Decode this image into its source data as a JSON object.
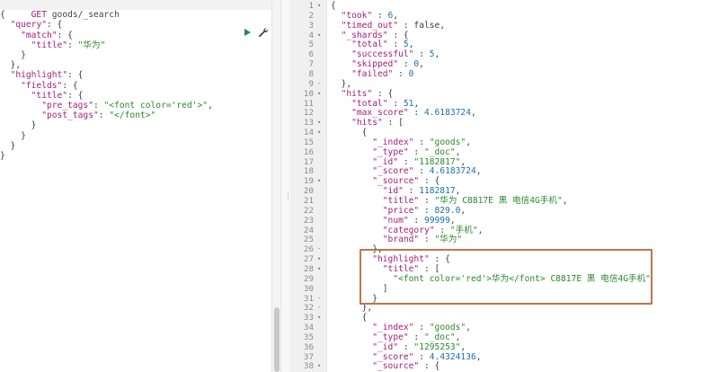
{
  "request": {
    "method": "GET",
    "path": "goods/_search",
    "body_lines": [
      "{",
      "  \"query\": {",
      "    \"match\": {",
      "      \"title\": \"华为\"",
      "    }",
      "  },",
      "  \"highlight\": {",
      "    \"fields\": {",
      "      \"title\": {",
      "        \"pre_tags\": \"<font color='red'>\",",
      "        \"post_tags\": \"</font>\"",
      "      }",
      "    }",
      "  }",
      "}"
    ]
  },
  "toolbar": {
    "run_icon": "play-icon",
    "settings_icon": "wrench-icon"
  },
  "response": {
    "line_numbers": [
      "1",
      "2",
      "3",
      "4",
      "5",
      "6",
      "7",
      "8",
      "9",
      "10",
      "11",
      "12",
      "13",
      "14",
      "15",
      "16",
      "17",
      "18",
      "19",
      "20",
      "21",
      "22",
      "23",
      "24",
      "25",
      "26",
      "27",
      "28",
      "29",
      "30",
      "31",
      "32",
      "33",
      "34",
      "35",
      "36",
      "37",
      "38"
    ],
    "lines": [
      "{",
      "  \"took\" : 6,",
      "  \"timed_out\" : false,",
      "  \"_shards\" : {",
      "    \"total\" : 5,",
      "    \"successful\" : 5,",
      "    \"skipped\" : 0,",
      "    \"failed\" : 0",
      "  },",
      "  \"hits\" : {",
      "    \"total\" : 51,",
      "    \"max_score\" : 4.6183724,",
      "    \"hits\" : [",
      "      {",
      "        \"_index\" : \"goods\",",
      "        \"_type\" : \"_doc\",",
      "        \"_id\" : \"1182817\",",
      "        \"_score\" : 4.6183724,",
      "        \"_source\" : {",
      "          \"id\" : 1182817,",
      "          \"title\" : \"华为 C8817E 黑 电信4G手机\",",
      "          \"price\" : 829.0,",
      "          \"num\" : 99999,",
      "          \"category\" : \"手机\",",
      "          \"brand\" : \"华为\"",
      "        },",
      "        \"highlight\" : {",
      "          \"title\" : [",
      "            \"<font color='red'>华为</font> C8817E 黑 电信4G手机\"",
      "          ]",
      "        }",
      "      },",
      "      {",
      "        \"_index\" : \"goods\",",
      "        \"_type\" : \"_doc\",",
      "        \"_id\" : \"1295253\",",
      "        \"_score\" : 4.4324136,",
      "        \"_source\" : {"
    ]
  },
  "colors": {
    "key": "#a41d7b",
    "string": "#2a8a2a",
    "number": "#1b6fb0",
    "highlight_box": "#c0754a",
    "run_button": "#1c8a64"
  }
}
